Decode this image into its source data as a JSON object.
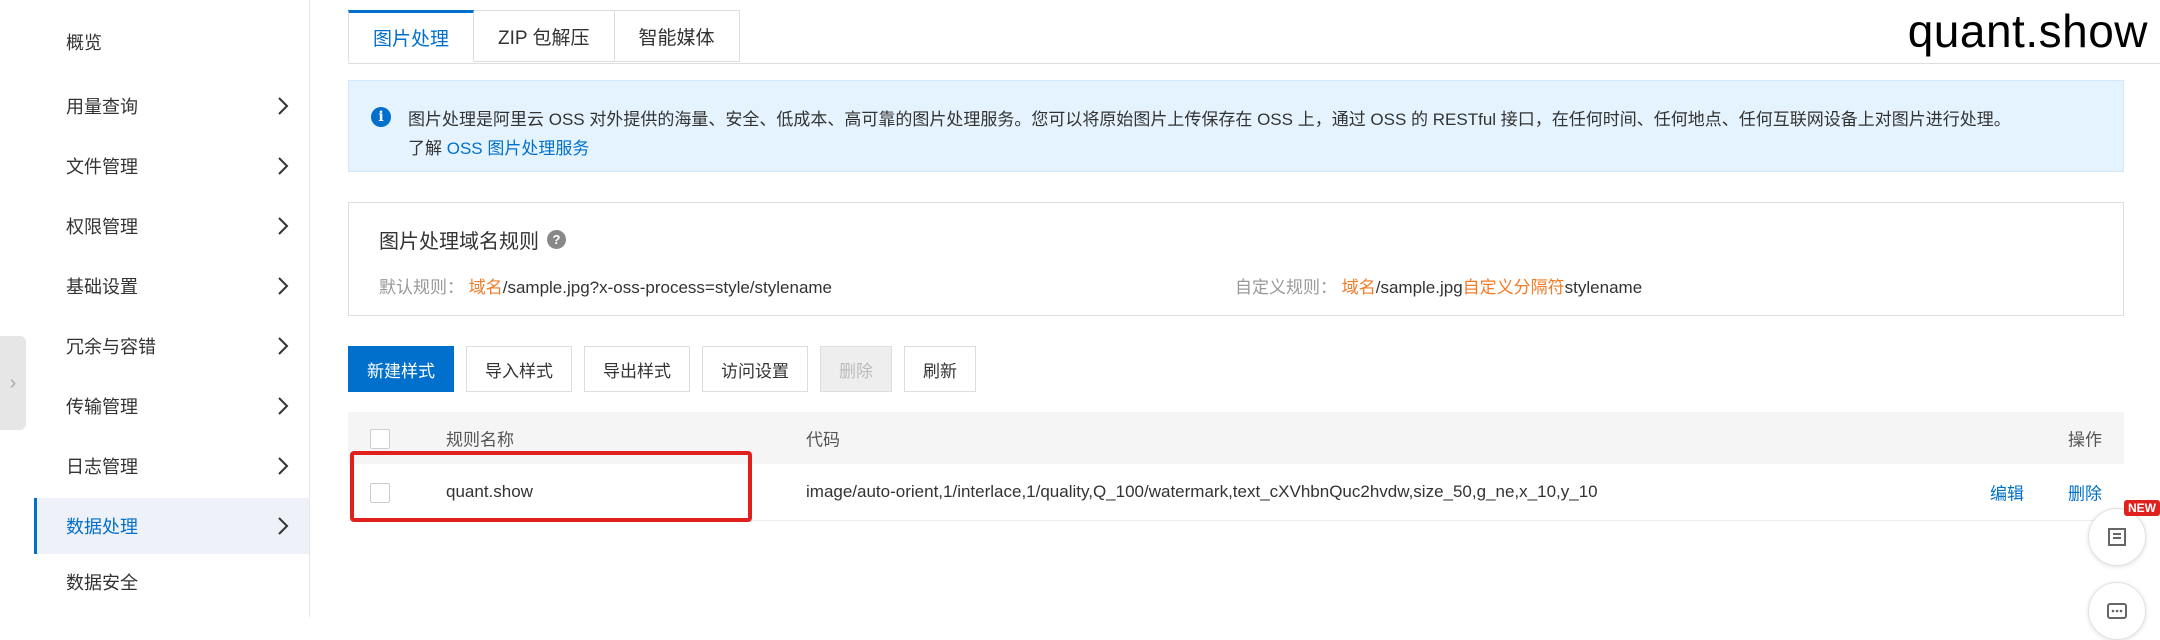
{
  "watermark": "quant.show",
  "sidebar": {
    "items": [
      {
        "label": "概览",
        "has_chevron": false
      },
      {
        "label": "用量查询",
        "has_chevron": true
      },
      {
        "label": "文件管理",
        "has_chevron": true
      },
      {
        "label": "权限管理",
        "has_chevron": true
      },
      {
        "label": "基础设置",
        "has_chevron": true
      },
      {
        "label": "冗余与容错",
        "has_chevron": true
      },
      {
        "label": "传输管理",
        "has_chevron": true
      },
      {
        "label": "日志管理",
        "has_chevron": true
      },
      {
        "label": "数据处理",
        "has_chevron": true,
        "active": true
      },
      {
        "label": "数据安全",
        "has_chevron": false
      }
    ]
  },
  "tabs": [
    {
      "label": "图片处理",
      "active": true
    },
    {
      "label": "ZIP 包解压"
    },
    {
      "label": "智能媒体"
    }
  ],
  "info": {
    "text": "图片处理是阿里云 OSS 对外提供的海量、安全、低成本、高可靠的图片处理服务。您可以将原始图片上传保存在 OSS 上，通过 OSS 的 RESTful 接口，在任何时间、任何地点、任何互联网设备上对图片进行处理。",
    "learn_prefix": "了解",
    "learn_link": "OSS 图片处理服务"
  },
  "rules": {
    "title": "图片处理域名规则",
    "default_label": "默认规则：",
    "default_domain": "域名",
    "default_path": "/sample.jpg?x-oss-process=style/stylename",
    "custom_label": "自定义规则：",
    "custom_domain": "域名",
    "custom_path": "/sample.jpg",
    "custom_sep": "自定义分隔符",
    "custom_style": "stylename"
  },
  "toolbar": {
    "new_style": "新建样式",
    "import_style": "导入样式",
    "export_style": "导出样式",
    "access_settings": "访问设置",
    "delete": "删除",
    "refresh": "刷新"
  },
  "table": {
    "headers": {
      "name": "规则名称",
      "code": "代码",
      "actions": "操作"
    },
    "rows": [
      {
        "name": "quant.show",
        "code": "image/auto-orient,1/interlace,1/quality,Q_100/watermark,text_cXVhbnQuc2hvdw,size_50,g_ne,x_10,y_10",
        "edit": "编辑",
        "delete": "删除"
      }
    ]
  },
  "float": {
    "new_badge": "NEW"
  },
  "colors": {
    "accent": "#0070cc",
    "highlight": "#e0201d",
    "orange": "#f07c28",
    "info_bg": "#e5f3ff"
  }
}
